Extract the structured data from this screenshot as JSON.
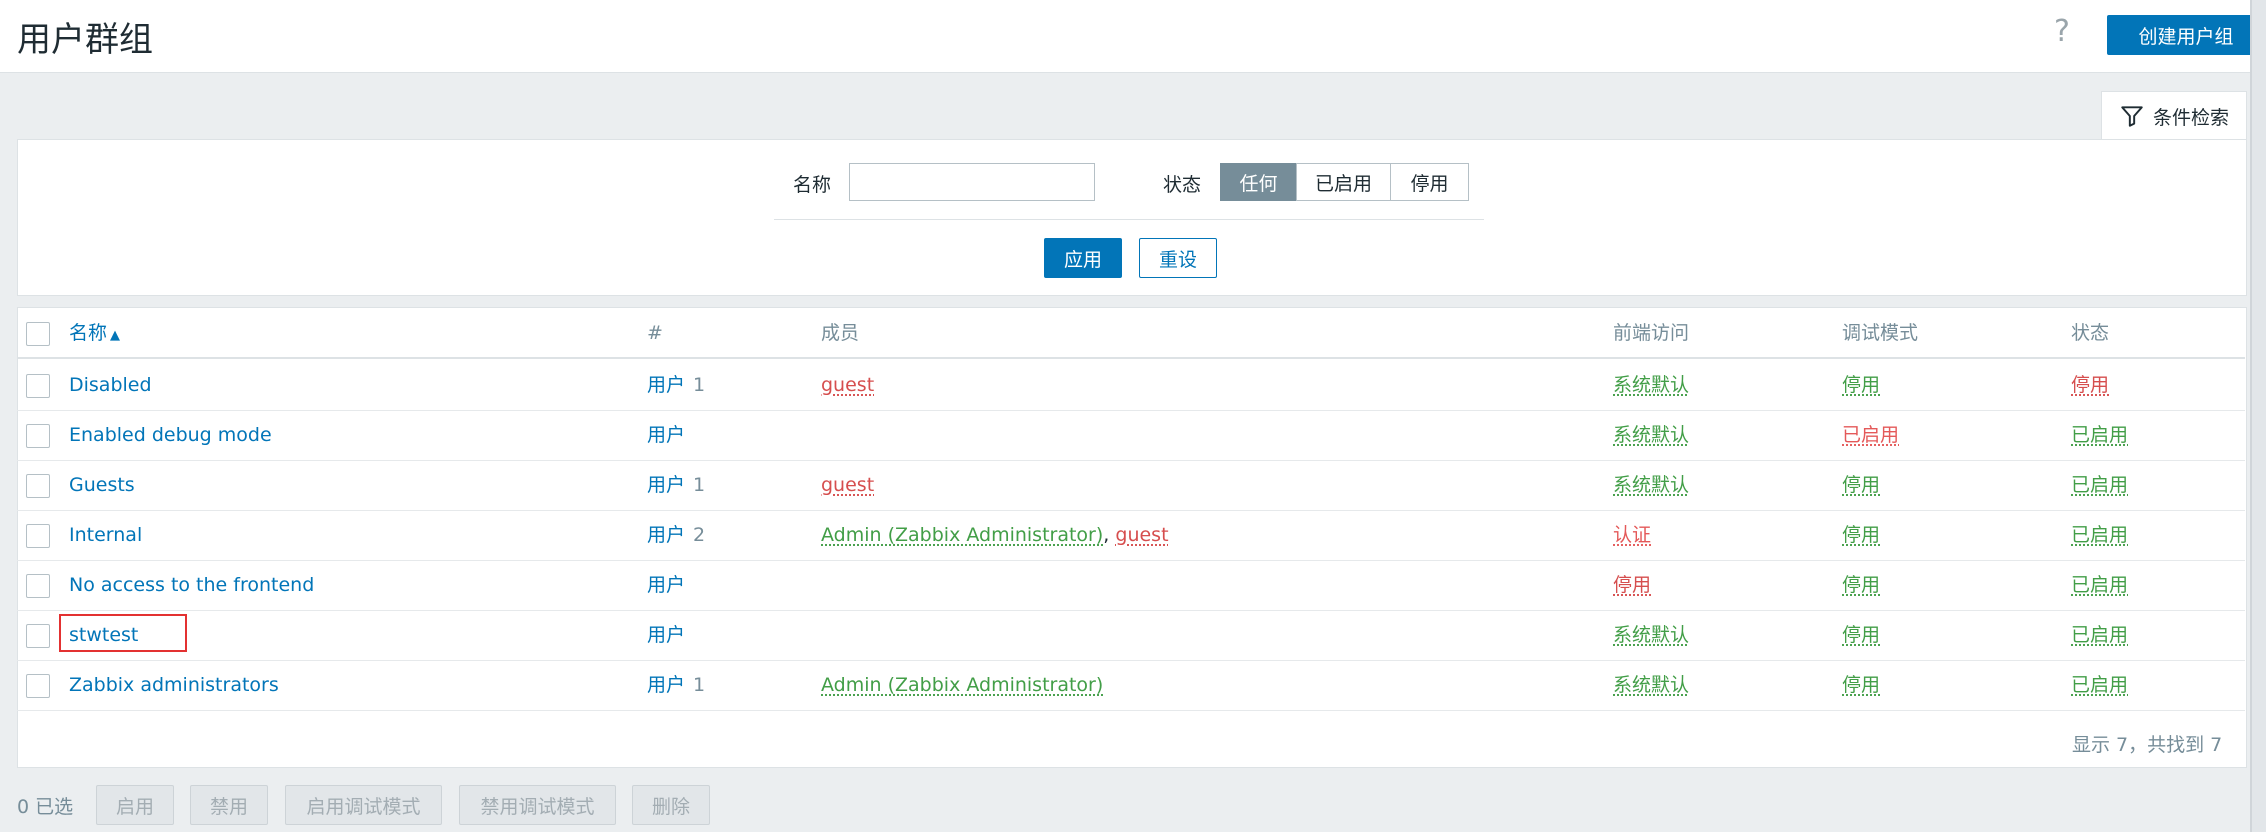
{
  "header": {
    "title": "用户群组",
    "help": "?",
    "create_label": "创建用户组"
  },
  "filter": {
    "tab_label": "条件检索",
    "name_label": "名称",
    "name_value": "",
    "status_label": "状态",
    "status_options": [
      "任何",
      "已启用",
      "停用"
    ],
    "status_selected": "任何",
    "apply_label": "应用",
    "reset_label": "重设"
  },
  "table": {
    "headers": {
      "name": "名称",
      "sort_indicator": "▲",
      "hash": "#",
      "members": "成员",
      "frontend": "前端访问",
      "debug": "调试模式",
      "status": "状态"
    },
    "rows": [
      {
        "name": "Disabled",
        "users_label": "用户",
        "users_count": "1",
        "members": [
          {
            "text": "guest",
            "color": "red"
          }
        ],
        "frontend": {
          "text": "系统默认",
          "color": "green"
        },
        "debug": {
          "text": "停用",
          "color": "green"
        },
        "status": {
          "text": "停用",
          "color": "red"
        }
      },
      {
        "name": "Enabled debug mode",
        "users_label": "用户",
        "users_count": "",
        "members": [],
        "frontend": {
          "text": "系统默认",
          "color": "green"
        },
        "debug": {
          "text": "已启用",
          "color": "orange"
        },
        "status": {
          "text": "已启用",
          "color": "green"
        }
      },
      {
        "name": "Guests",
        "users_label": "用户",
        "users_count": "1",
        "members": [
          {
            "text": "guest",
            "color": "red"
          }
        ],
        "frontend": {
          "text": "系统默认",
          "color": "green"
        },
        "debug": {
          "text": "停用",
          "color": "green"
        },
        "status": {
          "text": "已启用",
          "color": "green"
        }
      },
      {
        "name": "Internal",
        "users_label": "用户",
        "users_count": "2",
        "members": [
          {
            "text": "Admin (Zabbix Administrator)",
            "color": "green"
          },
          {
            "text": "guest",
            "color": "red"
          }
        ],
        "frontend": {
          "text": "认证",
          "color": "orange"
        },
        "debug": {
          "text": "停用",
          "color": "green"
        },
        "status": {
          "text": "已启用",
          "color": "green"
        }
      },
      {
        "name": "No access to the frontend",
        "users_label": "用户",
        "users_count": "",
        "members": [],
        "frontend": {
          "text": "停用",
          "color": "red"
        },
        "debug": {
          "text": "停用",
          "color": "green"
        },
        "status": {
          "text": "已启用",
          "color": "green"
        }
      },
      {
        "name": "stwtest",
        "users_label": "用户",
        "users_count": "",
        "members": [],
        "frontend": {
          "text": "系统默认",
          "color": "green"
        },
        "debug": {
          "text": "停用",
          "color": "green"
        },
        "status": {
          "text": "已启用",
          "color": "green"
        }
      },
      {
        "name": "Zabbix administrators",
        "users_label": "用户",
        "users_count": "1",
        "members": [
          {
            "text": "Admin (Zabbix Administrator)",
            "color": "green"
          }
        ],
        "frontend": {
          "text": "系统默认",
          "color": "green"
        },
        "debug": {
          "text": "停用",
          "color": "green"
        },
        "status": {
          "text": "已启用",
          "color": "green"
        }
      }
    ],
    "footer": "显示 7，共找到 7"
  },
  "mass_actions": {
    "selected_count": "0 已选",
    "buttons": [
      "启用",
      "禁用",
      "启用调试模式",
      "禁用调试模式",
      "删除"
    ]
  },
  "colors": {
    "accent": "#0275b8",
    "green": "#429e47",
    "red": "#d64e4e",
    "muted": "#768d99",
    "highlight_box": "#e33131"
  }
}
